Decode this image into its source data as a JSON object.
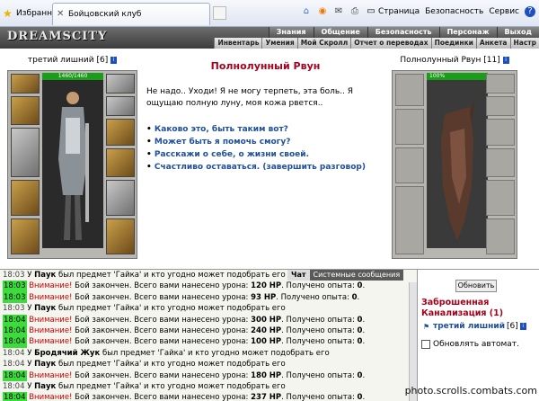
{
  "browser": {
    "favorites_label": "Избранное",
    "tab_title": "Бойцовский клуб",
    "menu_page": "Страница",
    "menu_security": "Безопасность",
    "menu_service": "Сервис"
  },
  "game": {
    "logo": "DREAMSCITY",
    "top_menu": [
      "Знания",
      "Общение",
      "Безопасность",
      "Персонаж",
      "Выход"
    ],
    "sub_menu": [
      "Инвентарь",
      "Умения",
      "Мой Скролл",
      "Отчет о переводах",
      "Поединки",
      "Анкета",
      "Настр"
    ]
  },
  "player": {
    "name": "третий лишний",
    "level": "[6]",
    "hp": "1460/1460"
  },
  "npc": {
    "name": "Полнолунный Рвун",
    "level": "[11]",
    "hp": "100%",
    "title": "Полнолунный Рвун",
    "speech": "Не надо.. Уходи! Я не могу терпеть, эта боль.. Я ощущаю полную луну, моя кожа рвется..",
    "options": [
      "Каково это, быть таким вот?",
      "Может быть я помочь смогу?",
      "Расскажи о себе, о жизни своей.",
      "Счастливо оставаться. (завершить разговор)"
    ]
  },
  "chat": {
    "tab_chat": "Чат",
    "tab_system": "Системные сообщения",
    "lines": [
      {
        "time": "18:03",
        "hl": false,
        "kind": "item",
        "who": "Паук",
        "text": " был предмет 'Гайка' и кто угодно может подобрать его"
      },
      {
        "time": "18:03",
        "hl": true,
        "kind": "battle",
        "dmg": "120 HP",
        "exp": "0"
      },
      {
        "time": "18:03",
        "hl": true,
        "kind": "battle",
        "dmg": "93 HP",
        "exp": "0"
      },
      {
        "time": "18:03",
        "hl": false,
        "kind": "item",
        "who": "Паук",
        "text": " был предмет 'Гайка' и кто угодно может подобрать его"
      },
      {
        "time": "18:04",
        "hl": true,
        "kind": "battle",
        "dmg": "300 HP",
        "exp": "0"
      },
      {
        "time": "18:04",
        "hl": true,
        "kind": "battle",
        "dmg": "240 HP",
        "exp": "0"
      },
      {
        "time": "18:04",
        "hl": true,
        "kind": "battle",
        "dmg": "100 HP",
        "exp": "0"
      },
      {
        "time": "18:04",
        "hl": false,
        "kind": "item",
        "who": "Бродячий Жук",
        "text": " был предмет 'Гайка' и кто угодно может подобрать его"
      },
      {
        "time": "18:04",
        "hl": false,
        "kind": "item",
        "who": "Паук",
        "text": " был предмет 'Гайка' и кто угодно может подобрать его"
      },
      {
        "time": "18:04",
        "hl": true,
        "kind": "battle",
        "dmg": "180 HP",
        "exp": "0"
      },
      {
        "time": "18:04",
        "hl": false,
        "kind": "item",
        "who": "Паук",
        "text": " был предмет 'Гайка' и кто угодно может подобрать его"
      },
      {
        "time": "18:04",
        "hl": true,
        "kind": "battle",
        "dmg": "237 HP",
        "exp": "0"
      }
    ],
    "prefix_item": " У ",
    "warn": "Внимание!",
    "battle_a": " Бой закончен. Всего вами нанесено урона: ",
    "battle_b": ". Получено опыта: ",
    "battle_c": "."
  },
  "sidebar": {
    "refresh": "Обновить",
    "location": "Заброшенная Канализация (1)",
    "player_name": "третий лишний",
    "player_level": "[6]",
    "auto_refresh": "Обновлять автомат."
  },
  "watermark": "photo.scrolls.combats.com",
  "colors": {
    "accent_red": "#a8001a",
    "link_blue": "#1f4fa0",
    "hp_green": "#1a9e1a",
    "time_highlight": "#3ddb3d"
  }
}
